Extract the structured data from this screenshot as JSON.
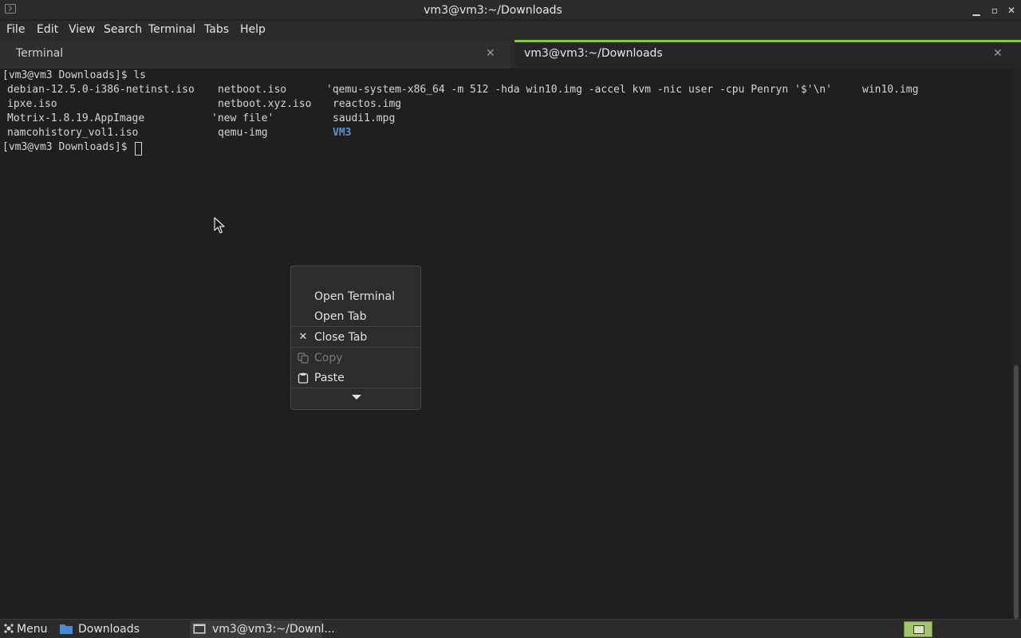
{
  "window": {
    "title": "vm3@vm3:~/Downloads",
    "controls": {
      "minimize": "▁",
      "maximize": "▫",
      "close": "✕"
    }
  },
  "menubar": {
    "items": [
      "File",
      "Edit",
      "View",
      "Search",
      "Terminal",
      "Tabs",
      "Help"
    ]
  },
  "tabs": [
    {
      "label": "Terminal",
      "active": false,
      "close": "✕"
    },
    {
      "label": "vm3@vm3:~/Downloads",
      "active": true,
      "close": "✕"
    }
  ],
  "terminal": {
    "line1": "[vm3@vm3 Downloads]$ ls",
    "files": {
      "c1r1": "debian-12.5.0-i386-netinst.iso",
      "c1r2": "ipxe.iso",
      "c1r3": "Motrix-1.8.19.AppImage",
      "c1r4": "namcohistory_vol1.iso",
      "c2r1": "netboot.iso",
      "c2r2": "netboot.xyz.iso",
      "c2r3": "'new file'",
      "c2r4": "qemu-img",
      "c3r1": "'qemu-system-x86_64 -m 512 -hda win10.img -accel kvm -nic user -cpu Penryn '$'\\n'",
      "c3r2": "reactos.img",
      "c3r3": "saudi1.mpg",
      "c3r4": "VM3",
      "c4r1": "win10.img"
    },
    "prompt": "[vm3@vm3 Downloads]$ "
  },
  "context_menu": {
    "open_terminal": "Open Terminal",
    "open_tab": "Open Tab",
    "close_tab": "Close Tab",
    "close_icon": "✕",
    "copy": "Copy",
    "paste": "Paste"
  },
  "taskbar": {
    "menu": "Menu",
    "downloads": "Downloads",
    "window": "vm3@vm3:~/Downl..."
  },
  "colors": {
    "accent": "#8cc63f",
    "directory": "#5f8fcf",
    "background": "#1f1f1f"
  }
}
